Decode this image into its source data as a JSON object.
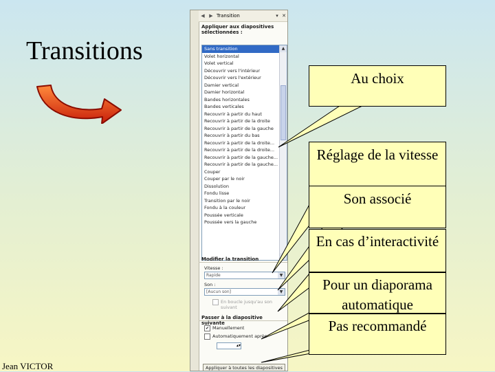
{
  "slide": {
    "title": "Transitions",
    "author": "Jean VICTOR"
  },
  "task_pane": {
    "header_title": "Transition",
    "apply_section_label": "Appliquer aux diapositives sélectionnées :",
    "effects": [
      "Sans transition",
      "Volet horizontal",
      "Volet vertical",
      "Découvrir vers l'intérieur",
      "Découvrir vers l'extérieur",
      "Damier vertical",
      "Damier horizontal",
      "Bandes horizontales",
      "Bandes verticales",
      "Recouvrir à partir du haut",
      "Recouvrir à partir de la droite",
      "Recouvrir à partir de la gauche",
      "Recouvrir à partir du bas",
      "Recouvrir à partir de la droite...",
      "Recouvrir à partir de la droite...",
      "Recouvrir à partir de la gauche...",
      "Recouvrir à partir de la gauche...",
      "Couper",
      "Couper par le noir",
      "Dissolution",
      "Fondu lisse",
      "Transition par le noir",
      "Fondu à la couleur",
      "Poussée verticale",
      "Poussée vers la gauche"
    ],
    "selected_effect_index": 0,
    "modify_section_label": "Modifier la transition",
    "speed_label": "Vitesse :",
    "speed_value": "Rapide",
    "sound_label": "Son :",
    "sound_value": "[Aucun son]",
    "loop_label": "En boucle jusqu'au son suivant",
    "advance_section_label": "Passer à la diapositive suivante",
    "on_click_label": "Manuellement",
    "on_click_checked": true,
    "auto_label": "Automatiquement après",
    "auto_checked": false,
    "apply_all_button": "Appliquer à toutes les diapositives"
  },
  "callouts": [
    "Au choix",
    "Réglage de la vitesse",
    "Son associé",
    "En cas d’interactivité",
    "Pour un diaporama automatique",
    "Pas recommandé"
  ],
  "colors": {
    "callout_fill": "#ffffb8",
    "arrow_fill": "#e03010",
    "list_selection": "#316ac5"
  }
}
